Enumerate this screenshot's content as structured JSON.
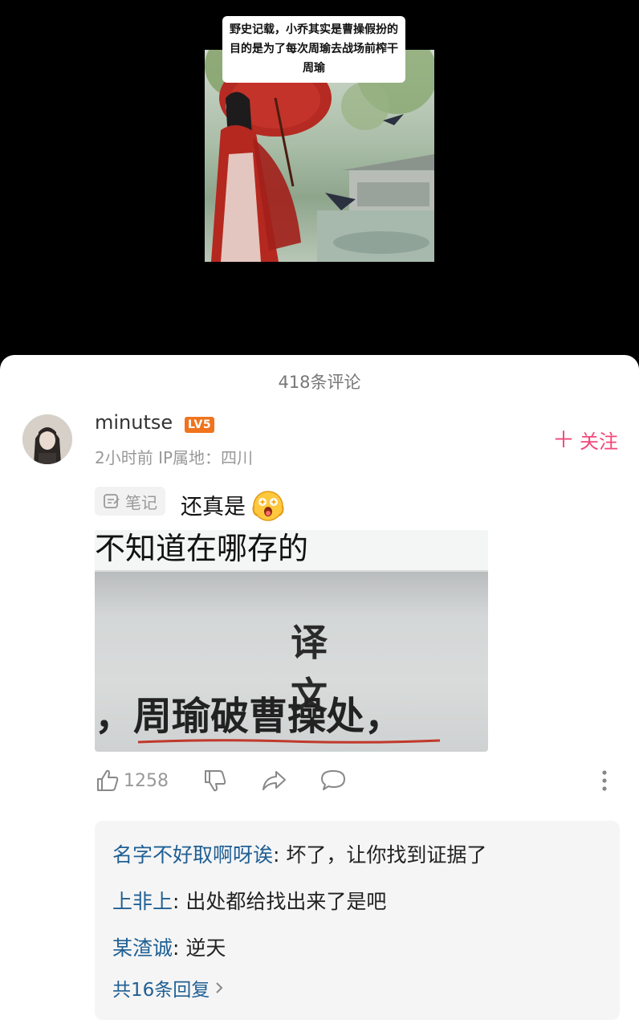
{
  "post": {
    "caption": "野史记载，小乔其实是曹操假扮的 目的是为了每次周瑜去战场前榨干周瑜"
  },
  "comments_panel": {
    "title": "418条评论"
  },
  "comment": {
    "username": "minutse",
    "level": "LV5",
    "meta": "2小时前  IP属地：四川",
    "follow_label": "关注",
    "note_tag": "笔记",
    "text": "还真是",
    "image_text_top": "不知道在哪存的",
    "image_text_heading": "译 文",
    "image_text_line": "，周瑜破曹操处，",
    "like_count": "1258"
  },
  "replies": [
    {
      "name": "名字不好取啊呀诶",
      "text": "坏了，让你找到证据了"
    },
    {
      "name": "上非上",
      "text": "出处都给找出来了是吧"
    },
    {
      "name": "某渣诚",
      "text": "逆天"
    }
  ],
  "more_replies_label": "共16条回复",
  "colors": {
    "accent_pink": "#f0487b",
    "link_blue": "#1f5f94",
    "level_orange": "#f0741e"
  },
  "icons": [
    "like-icon",
    "dislike-icon",
    "share-icon",
    "reply-icon",
    "more-icon",
    "note-icon",
    "chevron-right-icon",
    "plus-icon",
    "shocked-emoji-icon"
  ]
}
